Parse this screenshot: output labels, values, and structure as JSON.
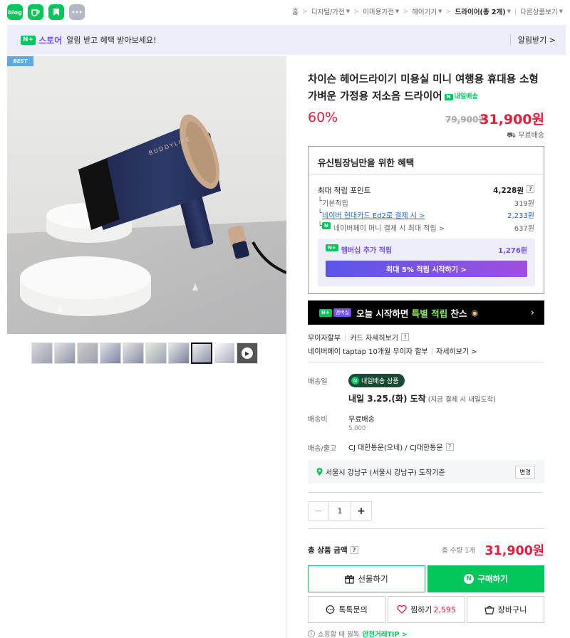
{
  "app_icons": [
    "blog",
    "cafe",
    "bookmark",
    "more"
  ],
  "breadcrumb": [
    {
      "label": "홈",
      "caret": false
    },
    {
      "label": "디지털/가전",
      "caret": true
    },
    {
      "label": "이미용가전",
      "caret": true
    },
    {
      "label": "헤어기기",
      "caret": true
    },
    {
      "label": "드라이어(총 2개)",
      "caret": true
    },
    {
      "label": "다른상품보기",
      "caret": true
    }
  ],
  "banner": {
    "nplus": "N+",
    "store": "스토어",
    "text": "알림 받고 혜택 받아보세요!",
    "alarm": "알림받기 >"
  },
  "best_badge": "BEST",
  "product": {
    "title": "차이슨 헤어드라이기 미용실 미니 여행용 휴대용 소형 가벼운 가정용 저소음 드라이어",
    "tomorrow_tag": "내일배송",
    "discount": "60%",
    "original_price": "79,900원",
    "price": "31,900원",
    "shipping": "무료배송"
  },
  "benefit": {
    "heading": "유신팀장님만을 위한 혜택",
    "max_points_label": "최대 적립 포인트",
    "max_points": "4,228원",
    "rows": [
      {
        "label": "기본적립",
        "value": "319원"
      },
      {
        "label": "네이버 현대카드 Ed2로 결제 시 >",
        "value": "2,233원"
      },
      {
        "label": "네이버페이 머니 결제 시 최대 적립 >",
        "value": "637원"
      }
    ],
    "member_label": "멤버십 추가 적립",
    "member_value": "1,276원",
    "member_btn": "최대 5% 적립 시작하기 >"
  },
  "promo": {
    "badge": "멤버십",
    "text_a": "오늘 시작하면 ",
    "text_hl": "특별 적립",
    "text_b": " 찬스"
  },
  "payment": {
    "line1_a": "무이자할부",
    "line1_b": "카드 자세히보기",
    "line2_a": "네이버페이 taptap 10개월 무이자 할부",
    "line2_b": "자세히보기 >"
  },
  "delivery": {
    "date_label": "배송일",
    "pill": "내일배송 상품",
    "arrive": "내일 3.25.(화) 도착",
    "arrive_note": "(지금 결제 시 내일도착)",
    "fee_label": "배송비",
    "fee": "무료배송",
    "fee_sub": "5,000",
    "carrier_label": "배송/출고",
    "carrier": "CJ 대한통운(오네) / CJ대한통운",
    "address": "서울시 강남구 (서울시 강남구) 도착기준",
    "change": "변경"
  },
  "quantity": {
    "minus": "−",
    "value": "1",
    "plus": "+"
  },
  "total": {
    "label": "총 상품 금액",
    "qty": "총 수량 1개",
    "price": "31,900원"
  },
  "buttons": {
    "gift": "선물하기",
    "buy": "구매하기",
    "talk": "톡톡문의",
    "wish": "찜하기",
    "wish_count": "2,595",
    "cart": "장바구니"
  },
  "tip": {
    "text": "쇼핑할 때 필독",
    "link": "안전거래TIP >"
  },
  "colors": {
    "accent": "#03c75a",
    "price": "#e31d3c",
    "purple": "#7151f0"
  }
}
